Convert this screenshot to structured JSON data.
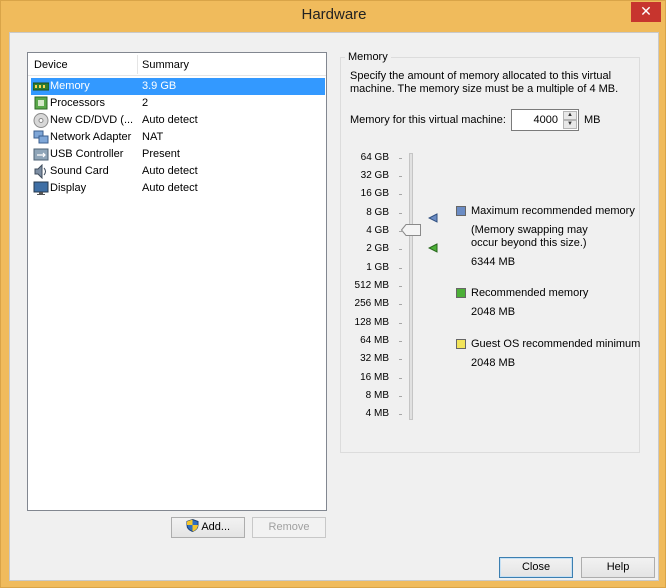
{
  "window": {
    "title": "Hardware"
  },
  "devices": {
    "header": {
      "device": "Device",
      "summary": "Summary"
    },
    "items": [
      {
        "name": "Memory",
        "summary": "3.9 GB",
        "icon": "memory-icon",
        "selected": true
      },
      {
        "name": "Processors",
        "summary": "2",
        "icon": "processor-icon"
      },
      {
        "name": "New CD/DVD (...",
        "summary": "Auto detect",
        "icon": "cd-dvd-icon"
      },
      {
        "name": "Network Adapter",
        "summary": "NAT",
        "icon": "network-adapter-icon"
      },
      {
        "name": "USB Controller",
        "summary": "Present",
        "icon": "usb-icon"
      },
      {
        "name": "Sound Card",
        "summary": "Auto detect",
        "icon": "sound-card-icon"
      },
      {
        "name": "Display",
        "summary": "Auto detect",
        "icon": "display-icon"
      }
    ],
    "add_label": "Add...",
    "remove_label": "Remove"
  },
  "memory": {
    "group_label": "Memory",
    "description": "Specify the amount of memory allocated to this virtual machine. The memory size must be a multiple of 4 MB.",
    "field_label": "Memory for this virtual machine:",
    "value": "4000",
    "unit": "MB",
    "scale": [
      "64 GB",
      "32 GB",
      "16 GB",
      "8 GB",
      "4 GB",
      "2 GB",
      "1 GB",
      "512 MB",
      "256 MB",
      "128 MB",
      "64 MB",
      "32 MB",
      "16 MB",
      "8 MB",
      "4 MB"
    ],
    "legend": {
      "max": {
        "label": "Maximum recommended memory",
        "note": "(Memory swapping may occur beyond this size.)",
        "value": "6344 MB",
        "color": "#6b8cc4"
      },
      "recommended": {
        "label": "Recommended memory",
        "value": "2048 MB",
        "color": "#4caf37"
      },
      "minimum": {
        "label": "Guest OS recommended minimum",
        "value": "2048 MB",
        "color": "#f2e45a"
      }
    }
  },
  "footer": {
    "close_label": "Close",
    "help_label": "Help"
  }
}
